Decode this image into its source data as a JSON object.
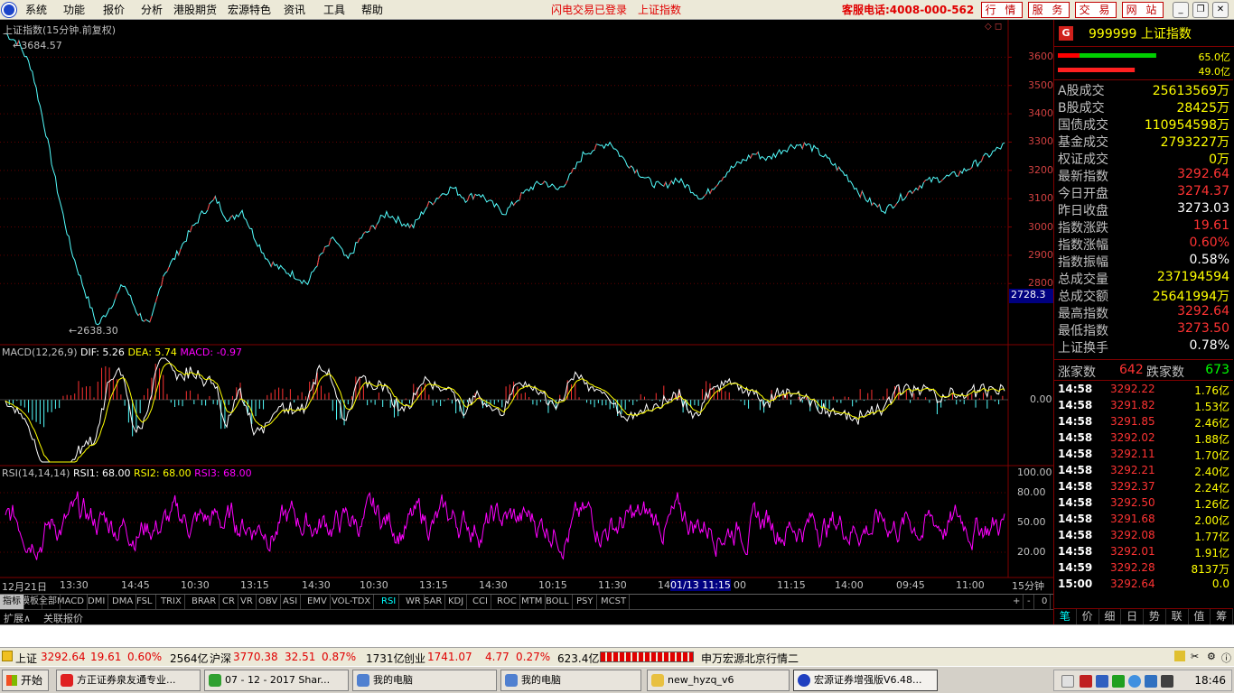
{
  "menubar": {
    "items": [
      "系统",
      "功能",
      "报价",
      "分析",
      "港股期货",
      "宏源特色",
      "资讯",
      "工具",
      "帮助"
    ],
    "status_login": "闪电交易已登录",
    "status_index": "上证指数",
    "phone": "客服电话:4008-000-562",
    "buttons": [
      "行 情",
      "服 务",
      "交 易",
      "网 站"
    ]
  },
  "chart": {
    "title": "上证指数(15分钟.前复权)",
    "high_label": "3684.57",
    "low_label": "2638.30",
    "price_cursor": "2728.3",
    "y_ticks": [
      "3600",
      "3500",
      "3400",
      "3300",
      "3200",
      "3100",
      "3000",
      "2900",
      "2800"
    ],
    "x_labels": [
      "12月21日",
      "13:30",
      "14:45",
      "10:30",
      "13:15",
      "14:30",
      "10:30",
      "13:15",
      "14:30",
      "10:15",
      "11:30",
      "14",
      "01/13 11:15",
      "00",
      "11:15",
      "14:00",
      "09:45",
      "11:00"
    ],
    "period": "15分钟",
    "macd_header": {
      "name": "MACD(12,26,9)",
      "dif": "DIF: 5.26",
      "dea": "DEA: 5.74",
      "macd": "MACD: -0.97"
    },
    "macd_zero": "0.00",
    "rsi_header": {
      "name": "RSI(14,14,14)",
      "rsi1": "RSI1: 68.00",
      "rsi2": "RSI2: 68.00",
      "rsi3": "RSI3: 68.00"
    },
    "rsi_ticks": [
      "100.00",
      "80.00",
      "50.00",
      "20.00"
    ],
    "colors": {
      "up": "#ff3232",
      "down": "#54ffff",
      "dif": "#ffffff",
      "dea": "#ffff00",
      "rsi": "#ff00ff",
      "axis": "#800000"
    }
  },
  "chart_data": {
    "type": "line",
    "title": "上证指数(15分钟.前复权)",
    "series": [
      {
        "name": "上证指数",
        "values": [
          3684,
          3650,
          3560,
          3350,
          3120,
          2920,
          2780,
          2650,
          2720,
          2800,
          2700,
          2650,
          2830,
          2900,
          2980,
          3050,
          3100,
          3020,
          3060,
          2960,
          2880,
          2850,
          2830,
          2800,
          2900,
          2960,
          2880,
          2960,
          3000,
          3050,
          3020,
          3000,
          3070,
          3110,
          3140,
          3100,
          3120,
          3080,
          3050,
          3100,
          3140,
          3160,
          3130,
          3180,
          3260,
          3280,
          3300,
          3240,
          3200,
          3160,
          3140,
          3170,
          3140,
          3100,
          3150,
          3200,
          3230,
          3260,
          3240,
          3270,
          3290,
          3290,
          3260,
          3220,
          3180,
          3120,
          3080,
          3060,
          3100,
          3130,
          3160,
          3170,
          3180,
          3200,
          3230,
          3260,
          3290
        ]
      }
    ],
    "ylim": [
      2600,
      3700
    ],
    "macd_range": [
      -80,
      50
    ],
    "rsi_range": [
      0,
      100
    ]
  },
  "panel": {
    "code": "999999 上证指数",
    "badge": "G",
    "bar_top_value": "65.0亿",
    "bar_bottom_value": "49.0亿",
    "bar_top_fraction": 0.55,
    "bar_bottom_fraction": 0.43,
    "rows": [
      {
        "k": "A股成交",
        "v": "25613569万",
        "c": "#ffff00"
      },
      {
        "k": "B股成交",
        "v": "28425万",
        "c": "#ffff00"
      },
      {
        "k": "国债成交",
        "v": "110954598万",
        "c": "#ffff00"
      },
      {
        "k": "基金成交",
        "v": "2793227万",
        "c": "#ffff00"
      },
      {
        "k": "权证成交",
        "v": "0万",
        "c": "#ffff00"
      },
      {
        "k": "最新指数",
        "v": "3292.64",
        "c": "#ff3333"
      },
      {
        "k": "今日开盘",
        "v": "3274.37",
        "c": "#ff3333"
      },
      {
        "k": "昨日收盘",
        "v": "3273.03",
        "c": "#ffffff"
      },
      {
        "k": "指数涨跌",
        "v": "19.61",
        "c": "#ff3333"
      },
      {
        "k": "指数涨幅",
        "v": "0.60%",
        "c": "#ff3333"
      },
      {
        "k": "指数振幅",
        "v": "0.58%",
        "c": "#ffffff"
      },
      {
        "k": "总成交量",
        "v": "237194594",
        "c": "#ffff00"
      },
      {
        "k": "总成交额",
        "v": "25641994万",
        "c": "#ffff00"
      },
      {
        "k": "最高指数",
        "v": "3292.64",
        "c": "#ff3333"
      },
      {
        "k": "最低指数",
        "v": "3273.50",
        "c": "#ff3333"
      },
      {
        "k": "上证换手",
        "v": "0.78%",
        "c": "#ffffff"
      }
    ],
    "advance_label": "涨家数",
    "advance_value": "642",
    "decline_label": "跌家数",
    "decline_value": "673",
    "ticks": [
      {
        "t": "14:58",
        "p": "3292.22",
        "v": "1.76亿"
      },
      {
        "t": "14:58",
        "p": "3291.82",
        "v": "1.53亿"
      },
      {
        "t": "14:58",
        "p": "3291.85",
        "v": "2.46亿"
      },
      {
        "t": "14:58",
        "p": "3292.02",
        "v": "1.88亿"
      },
      {
        "t": "14:58",
        "p": "3292.11",
        "v": "1.70亿"
      },
      {
        "t": "14:58",
        "p": "3292.21",
        "v": "2.40亿"
      },
      {
        "t": "14:58",
        "p": "3292.37",
        "v": "2.24亿"
      },
      {
        "t": "14:58",
        "p": "3292.50",
        "v": "1.26亿"
      },
      {
        "t": "14:58",
        "p": "3291.68",
        "v": "2.00亿"
      },
      {
        "t": "14:58",
        "p": "3292.08",
        "v": "1.77亿"
      },
      {
        "t": "14:58",
        "p": "3292.01",
        "v": "1.91亿"
      },
      {
        "t": "14:59",
        "p": "3292.28",
        "v": "8137万"
      },
      {
        "t": "15:00",
        "p": "3292.64",
        "v": "0.0"
      }
    ],
    "tabs": [
      "笔",
      "价",
      "细",
      "日",
      "势",
      "联",
      "值",
      "筹"
    ]
  },
  "indicators": [
    "指标",
    "模板",
    "全部",
    "MACD",
    "DMI",
    "DMA",
    "FSL",
    "TRIX",
    "BRAR",
    "CR",
    "VR",
    "OBV",
    "ASI",
    "EMV",
    "VOL-TDX",
    "RSI",
    "WR",
    "SAR",
    "KDJ",
    "CCI",
    "ROC",
    "MTM",
    "BOLL",
    "PSY",
    "MCST"
  ],
  "indicator_active": "RSI",
  "indicator_controls": [
    "+",
    "-",
    "0"
  ],
  "subtabs": [
    "扩展∧",
    "关联报价"
  ],
  "indexbar": {
    "sh_label": "上证",
    "sh_price": "3292.64",
    "sh_chg": "19.61",
    "sh_pct": "0.60%",
    "sh_amt": "2564亿",
    "hs_label": "沪深",
    "hs_price": "3770.38",
    "hs_chg": "32.51",
    "hs_pct": "0.87%",
    "hs_amt": "1731亿",
    "cy_label": "创业",
    "cy_price": "1741.07",
    "cy_chg": "4.77",
    "cy_pct": "0.27%",
    "cy_amt": "623.4亿",
    "server": "申万宏源北京行情二"
  },
  "taskbar": {
    "start": "开始",
    "tasks": [
      "方正证券泉友通专业...",
      "07 - 12 - 2017 Shar...",
      "我的电脑",
      "我的电脑",
      "new_hyzq_v6",
      "宏源证券增强版V6.48..."
    ],
    "clock": "18:46"
  }
}
